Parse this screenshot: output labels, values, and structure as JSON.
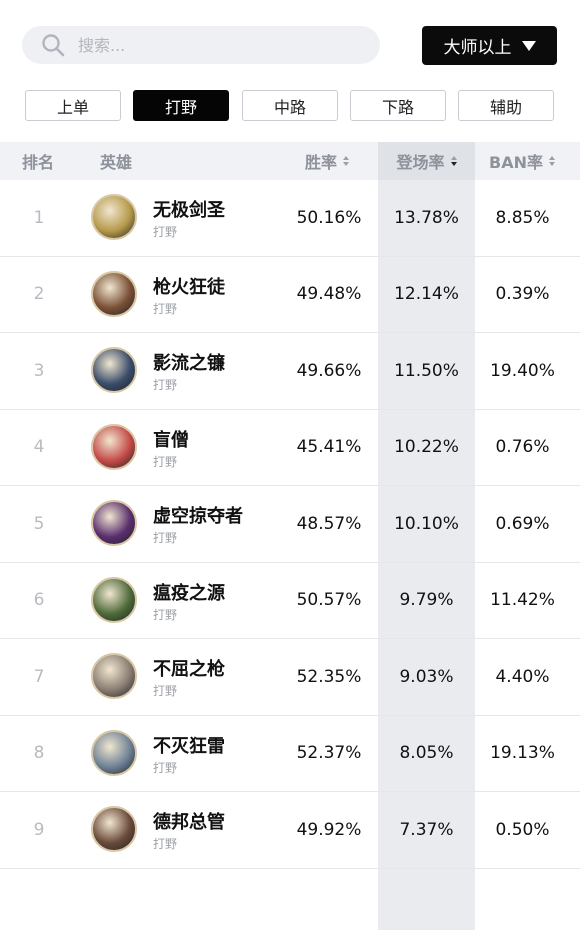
{
  "search": {
    "placeholder": "搜索..."
  },
  "rank_filter": {
    "label": "大师以上"
  },
  "tabs": [
    {
      "label": "上单"
    },
    {
      "label": "打野"
    },
    {
      "label": "中路"
    },
    {
      "label": "下路"
    },
    {
      "label": "辅助"
    }
  ],
  "active_tab_index": 1,
  "table": {
    "headers": {
      "rank": "排名",
      "hero": "英雄",
      "win": "胜率",
      "pick": "登场率",
      "ban": "BAN率"
    },
    "rows": [
      {
        "rank": "1",
        "name": "无极剑圣",
        "role": "打野",
        "win": "50.16%",
        "pick": "13.78%",
        "ban": "8.85%",
        "color": "#b69a4a"
      },
      {
        "rank": "2",
        "name": "枪火狂徒",
        "role": "打野",
        "win": "49.48%",
        "pick": "12.14%",
        "ban": "0.39%",
        "color": "#7a5036"
      },
      {
        "rank": "3",
        "name": "影流之镰",
        "role": "打野",
        "win": "49.66%",
        "pick": "11.50%",
        "ban": "19.40%",
        "color": "#3a4d6a"
      },
      {
        "rank": "4",
        "name": "盲僧",
        "role": "打野",
        "win": "45.41%",
        "pick": "10.22%",
        "ban": "0.76%",
        "color": "#c44b48"
      },
      {
        "rank": "5",
        "name": "虚空掠夺者",
        "role": "打野",
        "win": "48.57%",
        "pick": "10.10%",
        "ban": "0.69%",
        "color": "#5a2f6e"
      },
      {
        "rank": "6",
        "name": "瘟疫之源",
        "role": "打野",
        "win": "50.57%",
        "pick": "9.79%",
        "ban": "11.42%",
        "color": "#4e6a3a"
      },
      {
        "rank": "7",
        "name": "不屈之枪",
        "role": "打野",
        "win": "52.35%",
        "pick": "9.03%",
        "ban": "4.40%",
        "color": "#8a7d72"
      },
      {
        "rank": "8",
        "name": "不灭狂雷",
        "role": "打野",
        "win": "52.37%",
        "pick": "8.05%",
        "ban": "19.13%",
        "color": "#6f8296"
      },
      {
        "rank": "9",
        "name": "德邦总管",
        "role": "打野",
        "win": "49.92%",
        "pick": "7.37%",
        "ban": "0.50%",
        "color": "#6a4a3a"
      }
    ]
  }
}
